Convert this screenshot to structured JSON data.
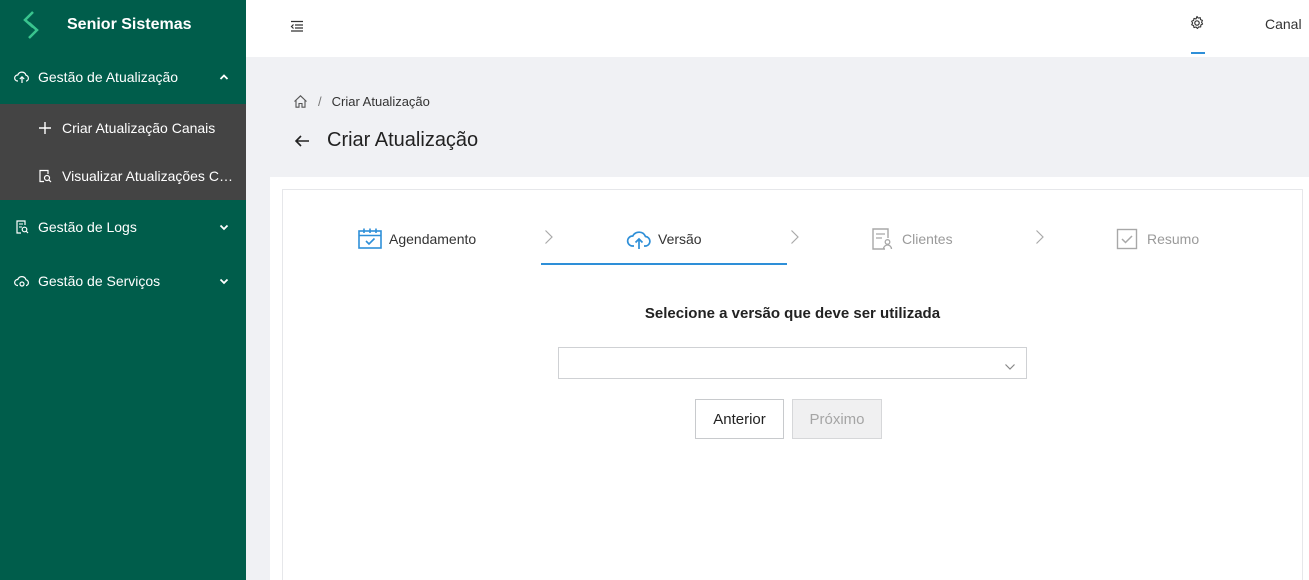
{
  "brand": {
    "name": "Senior Sistemas",
    "logo_icon": "senior-logo-icon"
  },
  "sidebar": {
    "groups": [
      {
        "label": "Gestão de Atualização",
        "icon": "cloud-upload-icon",
        "expanded": true,
        "items": [
          {
            "label": "Criar Atualização Canais",
            "icon": "plus-icon"
          },
          {
            "label": "Visualizar Atualizações Canais",
            "icon": "search-document-icon"
          }
        ]
      },
      {
        "label": "Gestão de Logs",
        "icon": "log-document-icon",
        "expanded": false
      },
      {
        "label": "Gestão de Serviços",
        "icon": "cloud-sync-icon",
        "expanded": false
      }
    ],
    "bg_color": "#005d4b",
    "submenu_bg_color": "#444444"
  },
  "topbar": {
    "collapse_icon": "menu-collapse-icon",
    "settings_icon": "gear-icon",
    "user_label": "Canal",
    "accent_color": "#2e8fd8"
  },
  "breadcrumb": {
    "home_icon": "home-icon",
    "separator": "/",
    "current": "Criar Atualização"
  },
  "page": {
    "title": "Criar Atualização",
    "back_icon": "arrow-left-icon"
  },
  "steps": [
    {
      "label": "Agendamento",
      "icon": "calendar-check-icon",
      "state": "done"
    },
    {
      "label": "Versão",
      "icon": "cloud-upload-icon",
      "state": "active"
    },
    {
      "label": "Clientes",
      "icon": "client-document-icon",
      "state": "todo"
    },
    {
      "label": "Resumo",
      "icon": "checkbox-icon",
      "state": "todo"
    }
  ],
  "form": {
    "question": "Selecione a versão que deve ser utilizada",
    "version_select": {
      "value": "",
      "icon": "chevron-down-icon"
    }
  },
  "buttons": {
    "previous": "Anterior",
    "next": "Próximo",
    "next_disabled": true
  }
}
